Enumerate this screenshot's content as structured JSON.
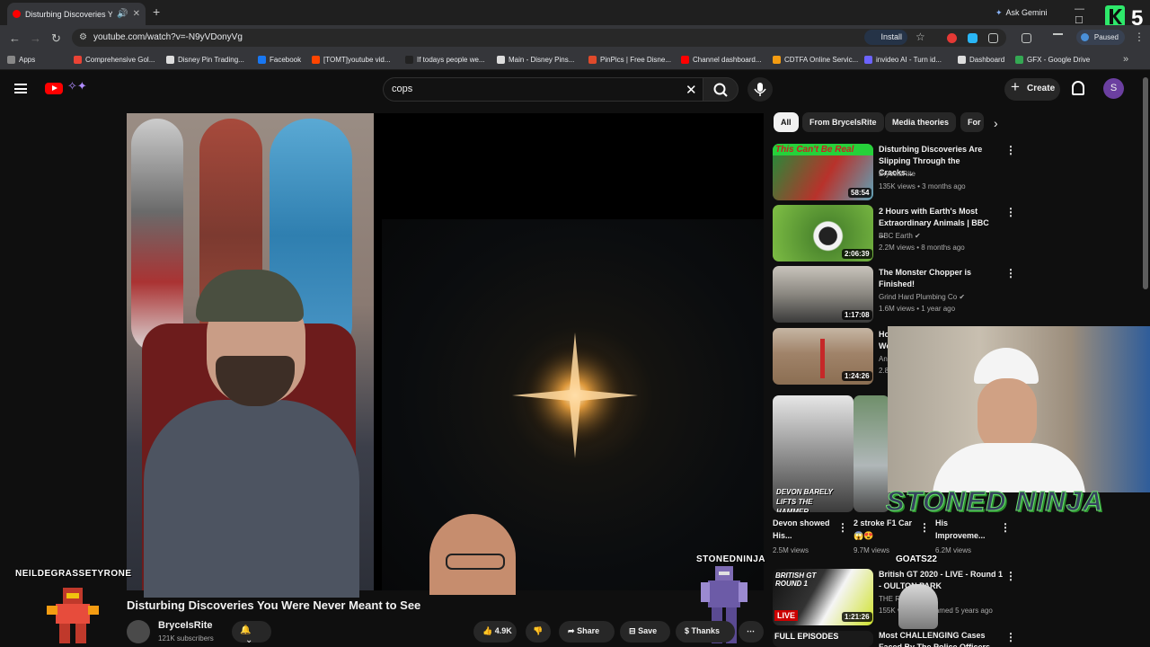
{
  "browser": {
    "tab_title": "Disturbing Discoveries You",
    "new_tab": "+",
    "ask_gemini": "Ask Gemini",
    "url": "youtube.com/watch?v=-N9yVDonyVg",
    "install": "Install",
    "paused": "Paused",
    "window_controls": "— ☐ ✕",
    "bookmarks": [
      {
        "label": "Apps",
        "color": "#888888"
      },
      {
        "label": "Comprehensive Gol...",
        "color": "#ea4335"
      },
      {
        "label": "Disney Pin Trading...",
        "color": "#dddddd"
      },
      {
        "label": "Facebook",
        "color": "#1877f2"
      },
      {
        "label": "[TOMT]youtube vid...",
        "color": "#ff4500"
      },
      {
        "label": "If todays people we...",
        "color": "#222222"
      },
      {
        "label": "Main - Disney Pins...",
        "color": "#dddddd"
      },
      {
        "label": "PinPics | Free Disne...",
        "color": "#e04a2b"
      },
      {
        "label": "Channel dashboard...",
        "color": "#ff0000"
      },
      {
        "label": "CDTFA Online Servic...",
        "color": "#f39c12"
      },
      {
        "label": "invideo AI - Turn id...",
        "color": "#6c63ff"
      },
      {
        "label": "Dashboard",
        "color": "#dddddd"
      },
      {
        "label": "GFX - Google Drive",
        "color": "#34a853"
      }
    ]
  },
  "youtube": {
    "search_value": "cops",
    "create": "Create",
    "avatar": "S"
  },
  "video": {
    "title": "Disturbing Discoveries You Were Never Meant to See",
    "channel": "BryceIsRite",
    "subscribers": "121K subscribers",
    "likes": "4.9K",
    "share": "Share",
    "save": "Save",
    "thanks": "Thanks",
    "overlay_left": "NEILDEGRASSETYRONE",
    "overlay_right": "STONEDNINJA"
  },
  "chips": [
    "All",
    "From BryceIsRite",
    "Media theories",
    "For"
  ],
  "recs": [
    {
      "title": "Disturbing Discoveries Are Slipping Through the Cracks...",
      "channel": "BryceIsRite",
      "meta": "135K views • 3 months ago",
      "duration": "58:54",
      "thumb_text": "This Can't Be Real",
      "verified": false
    },
    {
      "title": "2 Hours with Earth's Most Extraordinary Animals | BBC ...",
      "channel": "BBC Earth",
      "meta": "2.2M views • 8 months ago",
      "duration": "2:06:39",
      "verified": true
    },
    {
      "title": "The Monster Chopper is Finished!",
      "channel": "Grind Hard Plumbing Co",
      "meta": "1.6M views • 1 year ago",
      "duration": "1:17:08",
      "verified": true
    },
    {
      "title": "Ho Wo",
      "channel": "Ani",
      "meta": "2.8",
      "duration": "1:24:26",
      "verified": false
    }
  ],
  "shorts": [
    {
      "title": "Devon showed His...",
      "views": "2.5M views",
      "caption": "DEVON BARELY LIFTS THE HAMMER..."
    },
    {
      "title": "2 stroke F1 Car 😱😍",
      "views": "9.7M views"
    },
    {
      "title": "His Improveme...",
      "views": "6.2M views"
    }
  ],
  "recs_bottom": [
    {
      "title": "British GT 2020 - LIVE - Round 1 - OULTON PARK",
      "channel": "THE RACE",
      "meta": "155K views • Streamed 5 years ago",
      "duration": "1:21:26",
      "thumb_text": "BRITISH GT ROUND 1",
      "live": "LIVE"
    },
    {
      "title": "Most CHALLENGING Cases Faced By The Police Officers",
      "thumb_text": "FULL EPISODES"
    }
  ],
  "stream": {
    "banner": "STONED NINJA",
    "goats": "GOATS22",
    "counter": "5"
  }
}
